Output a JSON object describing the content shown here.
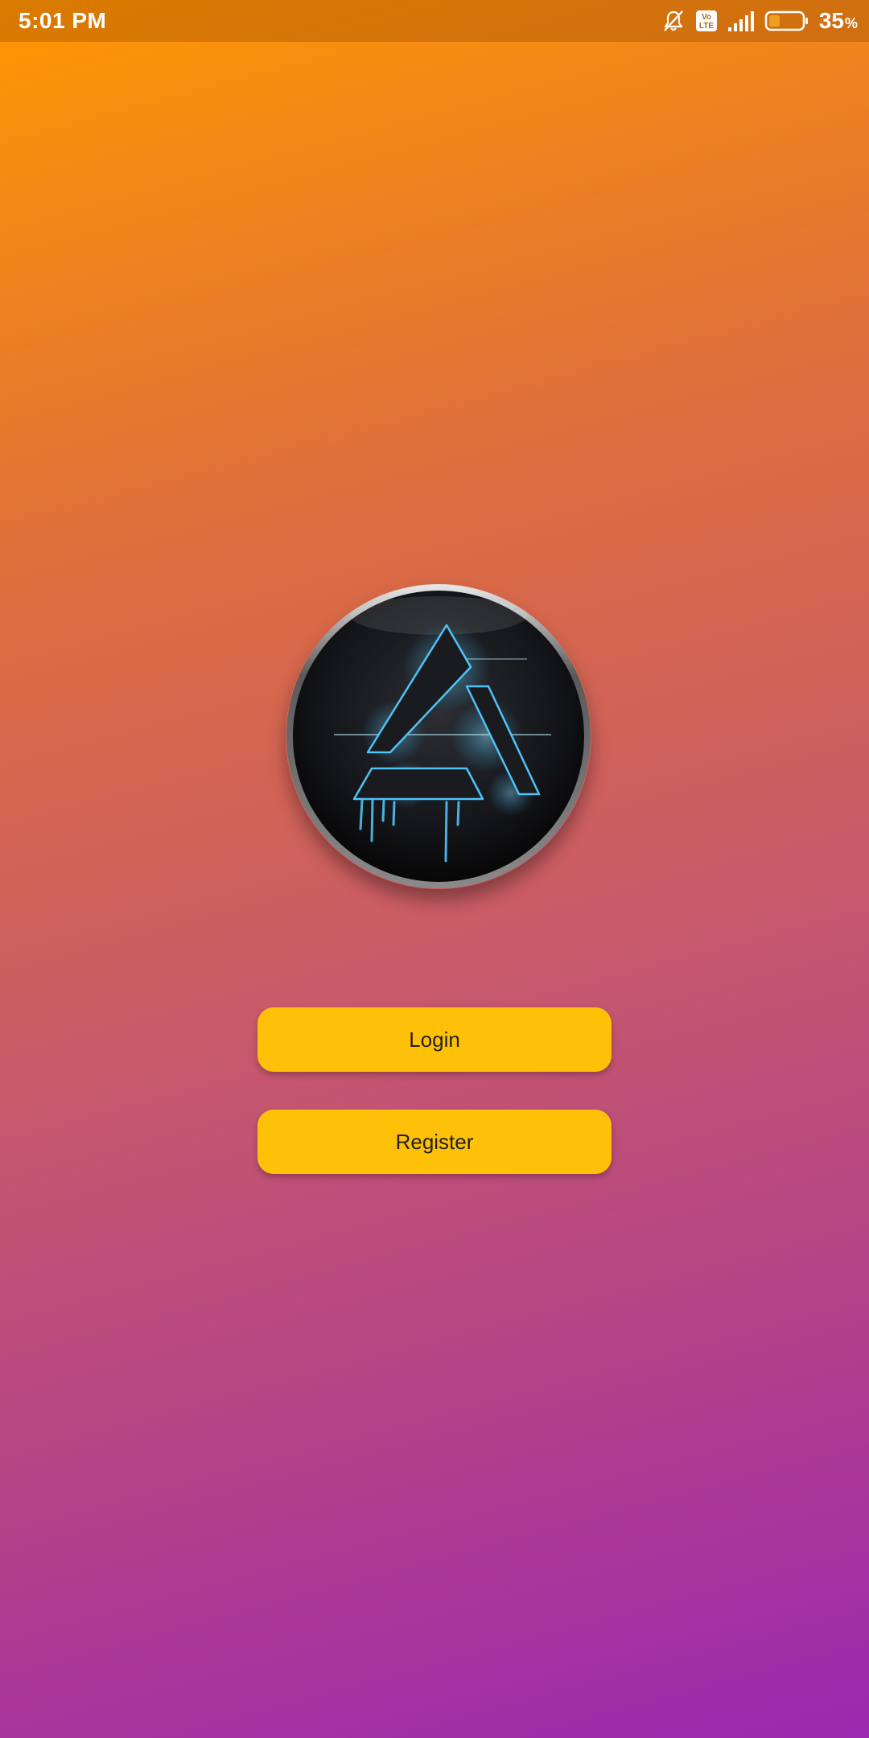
{
  "status_bar": {
    "time": "5:01 PM",
    "battery_percent": "35",
    "battery_percent_sign": "%",
    "volte_label_top": "Vo",
    "volte_label_bottom": "LTE",
    "icons": [
      "notifications-off-icon",
      "volte-icon",
      "signal-icon",
      "battery-icon"
    ]
  },
  "logo": {
    "icon": "triangle-emblem-logo",
    "accent_color": "#4fc3f7"
  },
  "buttons": {
    "login_label": "Login",
    "register_label": "Register"
  },
  "colors": {
    "gradient_start": "#ff9800",
    "gradient_end": "#9c27b0",
    "button_bg": "#ffc107",
    "button_text": "#1f1f1f"
  }
}
